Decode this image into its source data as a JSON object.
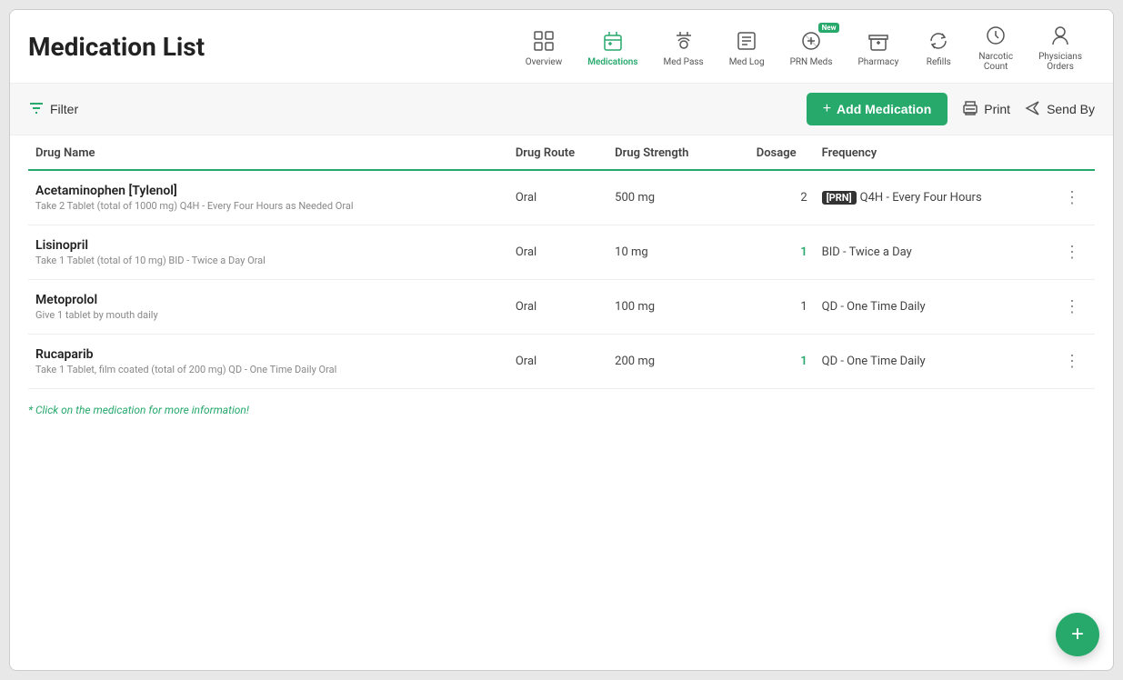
{
  "page": {
    "title": "Medication List"
  },
  "nav": {
    "items": [
      {
        "id": "overview",
        "label": "Overview",
        "active": false,
        "new": false
      },
      {
        "id": "medications",
        "label": "Medications",
        "active": true,
        "new": false
      },
      {
        "id": "med-pass",
        "label": "Med Pass",
        "active": false,
        "new": false
      },
      {
        "id": "med-log",
        "label": "Med Log",
        "active": false,
        "new": false
      },
      {
        "id": "prn-meds",
        "label": "PRN Meds",
        "active": false,
        "new": true
      },
      {
        "id": "pharmacy",
        "label": "Pharmacy",
        "active": false,
        "new": false
      },
      {
        "id": "refills",
        "label": "Refills",
        "active": false,
        "new": false
      },
      {
        "id": "narcotic-count",
        "label": "Narcotic Count",
        "active": false,
        "new": false
      },
      {
        "id": "physicians-orders",
        "label": "Physicians Orders",
        "active": false,
        "new": false
      }
    ]
  },
  "toolbar": {
    "filter_label": "Filter",
    "add_label": "Add Medication",
    "print_label": "Print",
    "sendby_label": "Send By"
  },
  "table": {
    "headers": {
      "drug_name": "Drug Name",
      "drug_route": "Drug Route",
      "drug_strength": "Drug Strength",
      "dosage": "Dosage",
      "frequency": "Frequency"
    },
    "rows": [
      {
        "name": "Acetaminophen [Tylenol]",
        "description": "Take 2 Tablet (total of 1000 mg) Q4H - Every Four Hours as Needed Oral",
        "route": "Oral",
        "strength": "500 mg",
        "dosage": "2",
        "dosage_link": false,
        "frequency": "Q4H - Every Four Hours",
        "prn": true
      },
      {
        "name": "Lisinopril",
        "description": "Take 1 Tablet (total of 10 mg) BID - Twice a Day Oral",
        "route": "Oral",
        "strength": "10 mg",
        "dosage": "1",
        "dosage_link": true,
        "frequency": "BID - Twice a Day",
        "prn": false
      },
      {
        "name": "Metoprolol",
        "description": "Give 1 tablet by mouth daily",
        "route": "Oral",
        "strength": "100 mg",
        "dosage": "1",
        "dosage_link": false,
        "frequency": "QD - One Time Daily",
        "prn": false
      },
      {
        "name": "Rucaparib",
        "description": "Take 1 Tablet, film coated (total of 200 mg) QD - One Time Daily Oral",
        "route": "Oral",
        "strength": "200 mg",
        "dosage": "1",
        "dosage_link": true,
        "frequency": "QD - One Time Daily",
        "prn": false
      }
    ]
  },
  "footer_note": "* Click on the medication for more information!",
  "colors": {
    "green": "#27a96c",
    "text_dark": "#222",
    "text_muted": "#888"
  }
}
